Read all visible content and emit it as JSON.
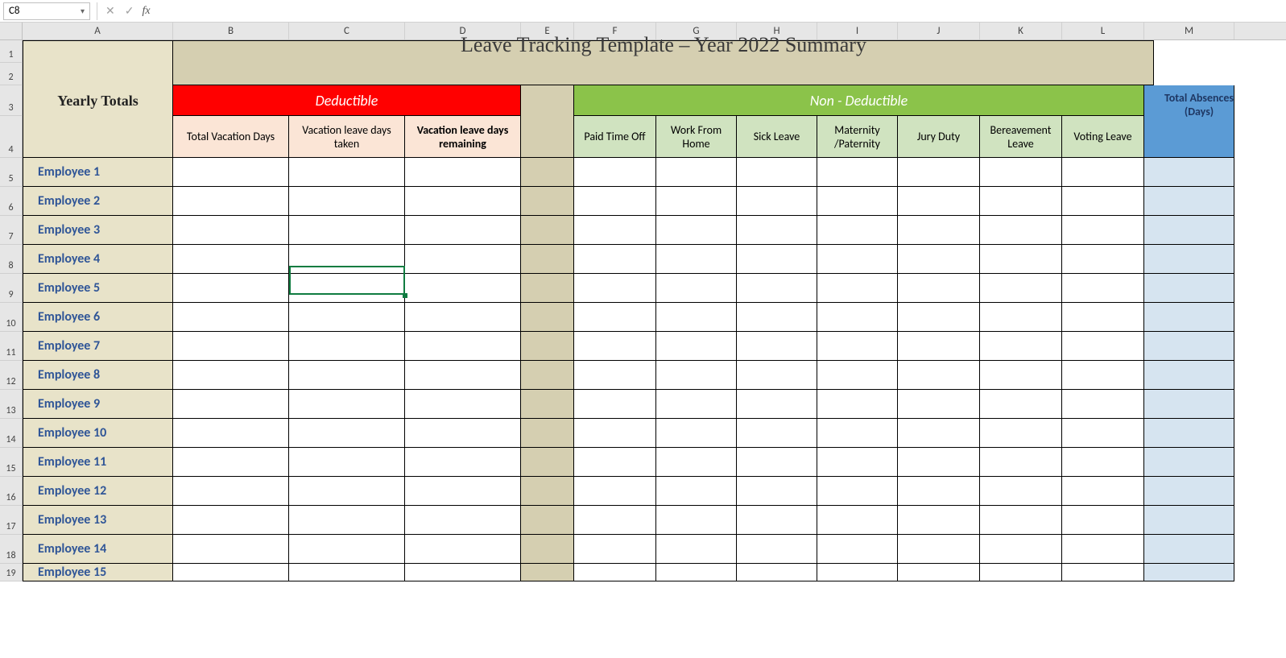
{
  "formulaBar": {
    "cellRef": "C8",
    "formula": ""
  },
  "columns": [
    "A",
    "B",
    "C",
    "D",
    "E",
    "F",
    "G",
    "H",
    "I",
    "J",
    "K",
    "L",
    "M"
  ],
  "rowNumbers": [
    "1",
    "2",
    "3",
    "4",
    "5",
    "6",
    "7",
    "8",
    "9",
    "10",
    "11",
    "12",
    "13",
    "14",
    "15",
    "16",
    "17",
    "18",
    "19"
  ],
  "title": "Leave Tracking Template – Year 2022 Summary",
  "yearlyTotals": "Yearly Totals",
  "deductible": "Deductible",
  "nonDeductible": "Non - Deductible",
  "totalAbsences": "Total Absences (Days)",
  "dedCols": {
    "b": "Total Vacation Days",
    "c": "Vacation leave days taken",
    "d": "Vacation leave days remaining"
  },
  "nondedCols": {
    "f": "Paid Time Off",
    "g": "Work From Home",
    "h": "Sick Leave",
    "i": "Maternity /Paternity",
    "j": "Jury Duty",
    "k": "Bereavement Leave",
    "l": "Voting Leave"
  },
  "employees": [
    "Employee 1",
    "Employee 2",
    "Employee 3",
    "Employee 4",
    "Employee 5",
    "Employee 6",
    "Employee 7",
    "Employee 8",
    "Employee 9",
    "Employee 10",
    "Employee 11",
    "Employee 12",
    "Employee 13",
    "Employee 14",
    "Employee 15"
  ],
  "activeCell": "C8"
}
